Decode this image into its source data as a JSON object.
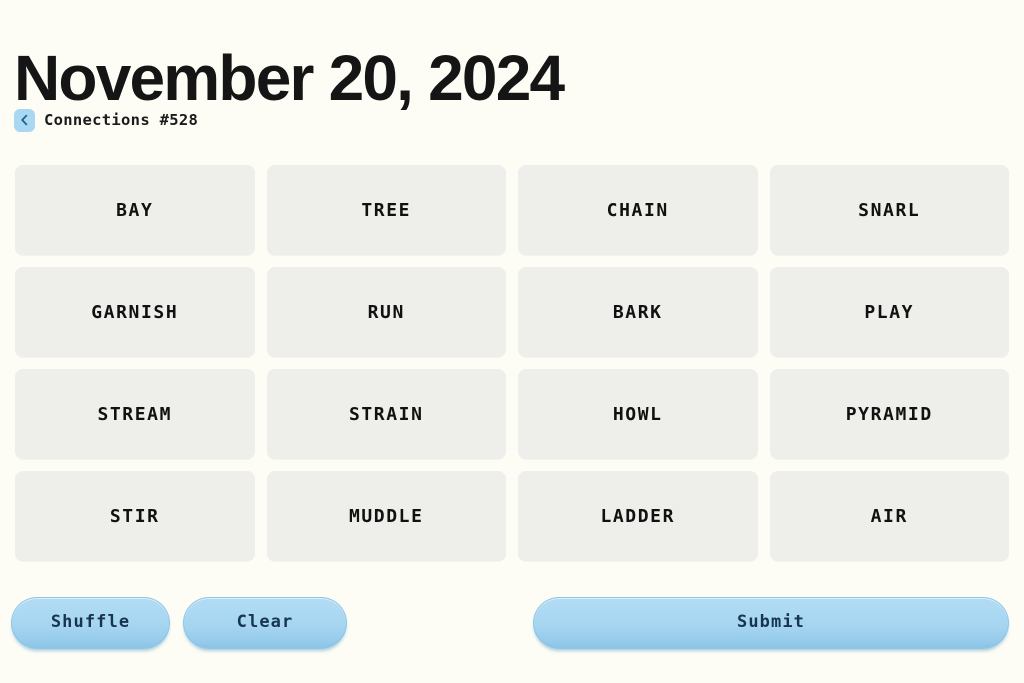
{
  "header": {
    "title": "November 20, 2024",
    "back_icon": "chevron-left-icon",
    "puzzle_label": "Connections #528"
  },
  "grid": {
    "rows": [
      [
        "BAY",
        "TREE",
        "CHAIN",
        "SNARL"
      ],
      [
        "GARNISH",
        "RUN",
        "BARK",
        "PLAY"
      ],
      [
        "STREAM",
        "STRAIN",
        "HOWL",
        "PYRAMID"
      ],
      [
        "STIR",
        "MUDDLE",
        "LADDER",
        "AIR"
      ]
    ]
  },
  "controls": {
    "shuffle_label": "Shuffle",
    "clear_label": "Clear",
    "submit_label": "Submit"
  },
  "colors": {
    "page_background": "#fdfdf6",
    "tile_background": "#eeeeea",
    "tile_text": "#111111",
    "button_blue": "#a7d6f1",
    "button_text": "#17354f",
    "back_badge_blue": "#a8d8f2",
    "title_text": "#151515"
  }
}
